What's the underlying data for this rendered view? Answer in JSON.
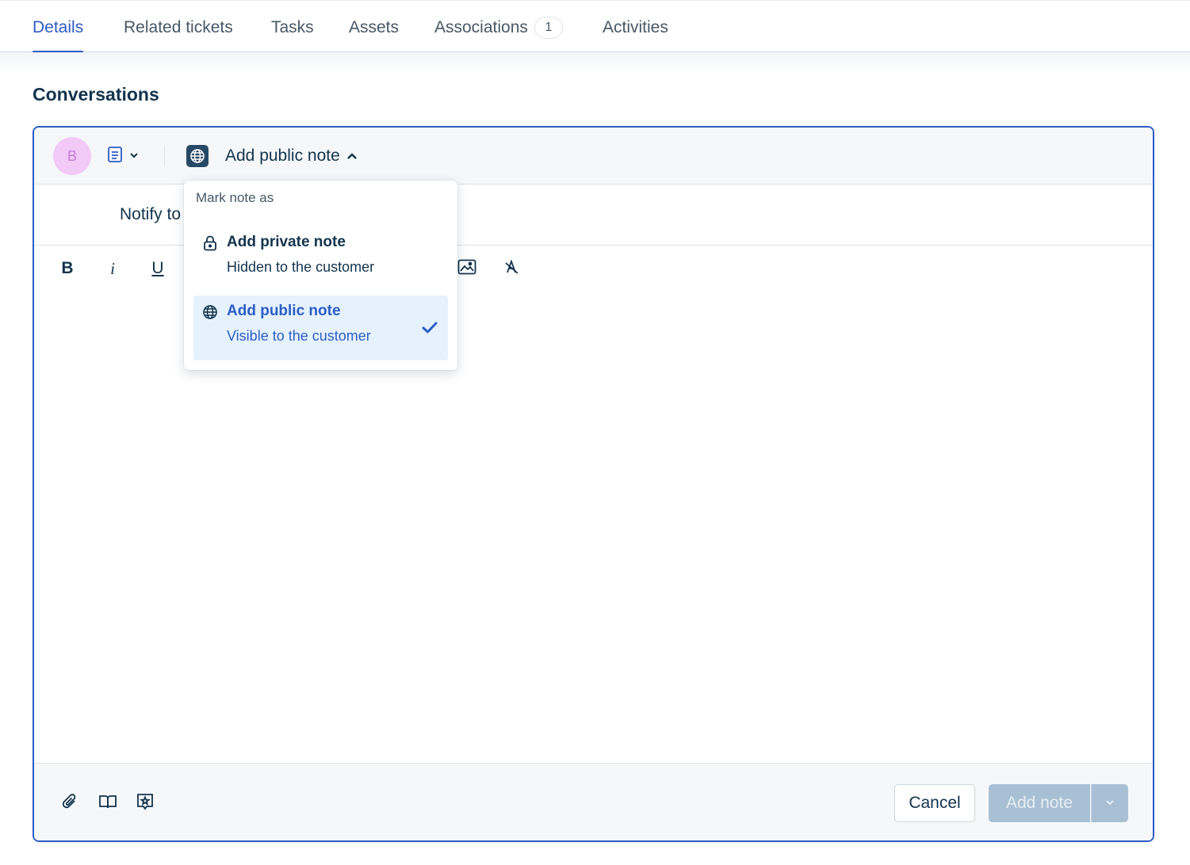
{
  "tabs": [
    {
      "label": "Details",
      "active": true
    },
    {
      "label": "Related tickets"
    },
    {
      "label": "Tasks"
    },
    {
      "label": "Assets"
    },
    {
      "label": "Associations",
      "count": "1"
    },
    {
      "label": "Activities"
    }
  ],
  "section_title": "Conversations",
  "editor": {
    "avatar_initial": "B",
    "note_type_label": "Add public note",
    "notify_label": "Notify to",
    "format_buttons": {
      "bold": "B",
      "italic": "i",
      "underline": "U"
    },
    "cancel_label": "Cancel",
    "submit_label": "Add note"
  },
  "dropdown": {
    "header": "Mark note as",
    "options": [
      {
        "title": "Add private note",
        "subtitle": "Hidden to the customer",
        "icon": "lock-icon",
        "selected": false
      },
      {
        "title": "Add public note",
        "subtitle": "Visible to the customer",
        "icon": "globe-icon",
        "selected": true
      }
    ]
  },
  "colors": {
    "accent": "#2c5cc5",
    "text": "#12344d",
    "selected_bg": "#e5f2fd",
    "disabled_button": "#a9c0d4",
    "avatar_bg": "#f3c9f7"
  }
}
